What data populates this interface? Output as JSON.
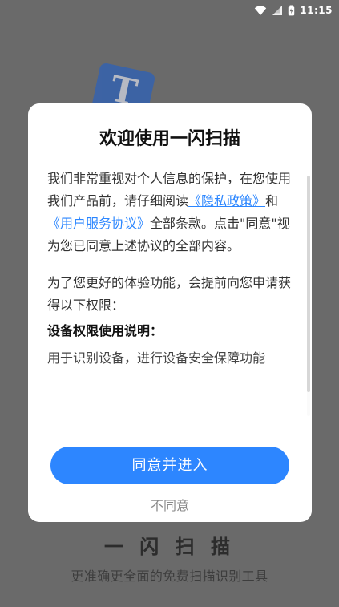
{
  "status_bar": {
    "time": "11:15",
    "icons": [
      "wifi-icon",
      "signal-icon",
      "battery-icon"
    ]
  },
  "background": {
    "logo_letter": "T",
    "app_name": "一 闪 扫 描",
    "tagline": "更准确更全面的免费扫描识别工具"
  },
  "dialog": {
    "title": "欢迎使用一闪扫描",
    "intro": {
      "part1": "我们非常重视对个人信息的保护，在您使用我们产品前，请仔细阅读",
      "privacy_link": "《隐私政策》",
      "and": "和",
      "terms_link": "《用户服务协议》",
      "part2": "全部条款。点击\"同意\"视为您已同意上述协议的全部内容。"
    },
    "permissions_intro": "为了您更好的体验功能，会提前向您申请获得以下权限：",
    "device_permission_title": "设备权限使用说明：",
    "device_permission_desc": "用于识别设备，进行设备安全保障功能",
    "agree_label": "同意并进入",
    "disagree_label": "不同意"
  },
  "colors": {
    "primary_blue": "#2d86ff",
    "link_blue": "#2b86ff",
    "overlay_gray": "#6a6a6a"
  }
}
